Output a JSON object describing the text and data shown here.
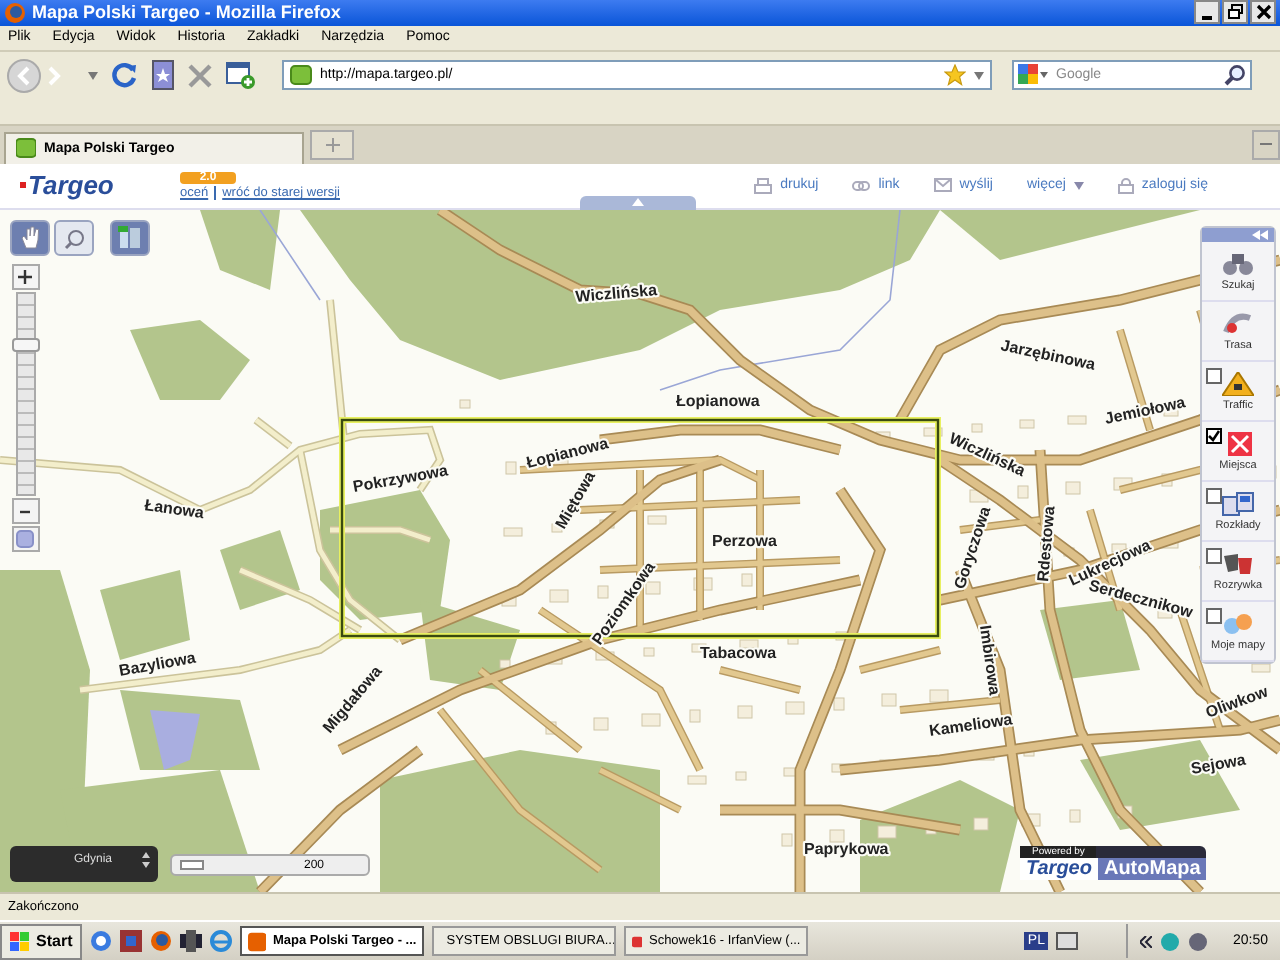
{
  "window": {
    "title": "Mapa Polski Targeo - Mozilla Firefox"
  },
  "menu": [
    "Plik",
    "Edycja",
    "Widok",
    "Historia",
    "Zakładki",
    "Narzędzia",
    "Pomoc"
  ],
  "toolbar": {
    "url": "http://mapa.targeo.pl/",
    "search_placeholder": "Google"
  },
  "tabs": [
    {
      "label": "Mapa Polski Targeo",
      "selected": true
    }
  ],
  "page_header": {
    "logo": "Targeo",
    "version_badge": "2.0",
    "links": [
      "oceń",
      "wróć do starej wersji"
    ],
    "actions": [
      {
        "label": "drukuj",
        "kind": "print"
      },
      {
        "label": "link",
        "kind": "link"
      },
      {
        "label": "wyślij",
        "kind": "mail"
      },
      {
        "label": "więcej",
        "kind": "menu"
      },
      {
        "label": "zaloguj się",
        "kind": "login"
      }
    ]
  },
  "map": {
    "street_labels": [
      "Wiczlińska",
      "Łopianowa",
      "Łopianowa",
      "Pokrzywowa",
      "Łanowa",
      "Miętowa",
      "Perzowa",
      "Poziomkowa",
      "Bazyliowa",
      "Migdałowa",
      "Tabacowa",
      "Wiczlińska",
      "Jarzębinowa",
      "Jemiołowa",
      "Goryczowa",
      "Rdestowa",
      "Lukrecjowa",
      "Serdecznikow",
      "Oliwkow",
      "Imbirowa",
      "Kameliowa",
      "Sejowa",
      "Paprykowa"
    ],
    "zoom": {
      "level": 0.75
    },
    "panel": [
      {
        "label": "Szukaj",
        "kind": "tool"
      },
      {
        "label": "Trasa",
        "kind": "tool"
      },
      {
        "label": "Traffic",
        "kind": "layer",
        "checked": false
      },
      {
        "label": "Miejsca",
        "kind": "layer",
        "checked": true
      },
      {
        "label": "Rozkłady",
        "kind": "layer",
        "checked": false
      },
      {
        "label": "Rozrywka",
        "kind": "layer",
        "checked": false
      },
      {
        "label": "Moje mapy",
        "kind": "layer",
        "checked": false
      }
    ],
    "city": "Gdynia",
    "scale": "200",
    "powered_by": "Powered by",
    "brand_logos": [
      "Targeo",
      "AutoMapa"
    ]
  },
  "status_bar": "Zakończono",
  "taskbar": {
    "start": "Start",
    "tasks": [
      {
        "label": "Mapa Polski Targeo - ...",
        "selected": true
      },
      {
        "label": "SYSTEM OBSLUGI BIURA...",
        "selected": false
      },
      {
        "label": "Schowek16 - IrfanView (...",
        "selected": false
      }
    ],
    "language": "PL",
    "clock": "20:50"
  }
}
